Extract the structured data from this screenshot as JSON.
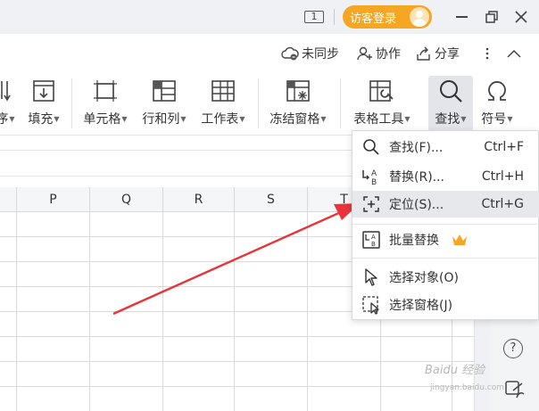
{
  "titlebar": {
    "page_count": "1",
    "login_label": "访客登录"
  },
  "collab": {
    "sync_label": "未同步",
    "collab_label": "协作",
    "share_label": "分享"
  },
  "ribbon": {
    "items": [
      {
        "label": "序"
      },
      {
        "label": "填充"
      },
      {
        "label": "单元格"
      },
      {
        "label": "行和列"
      },
      {
        "label": "工作表"
      },
      {
        "label": "冻结窗格"
      },
      {
        "label": "表格工具"
      },
      {
        "label": "查找"
      },
      {
        "label": "符号"
      }
    ]
  },
  "columns": [
    "P",
    "Q",
    "R",
    "S",
    "T"
  ],
  "dropdown": {
    "items": [
      {
        "label": "查找(F)...",
        "shortcut": "Ctrl+F",
        "icon": "search-icon"
      },
      {
        "label": "替换(R)...",
        "shortcut": "Ctrl+H",
        "icon": "replace-icon"
      },
      {
        "label": "定位(S)...",
        "shortcut": "Ctrl+G",
        "icon": "locate-icon"
      },
      {
        "label": "批量替换",
        "icon": "batch-replace-icon",
        "badge": "crown-icon"
      },
      {
        "label": "选择对象(O)",
        "icon": "cursor-icon"
      },
      {
        "label": "选择窗格(J)",
        "icon": "selection-pane-icon"
      }
    ]
  },
  "colors": {
    "login_button": "#f5a623",
    "annotation_arrow": "#e8343a",
    "crown": "#f5a623"
  },
  "watermark": {
    "brand": "Baidu 经验",
    "url": "jingyan.baidu.com"
  }
}
